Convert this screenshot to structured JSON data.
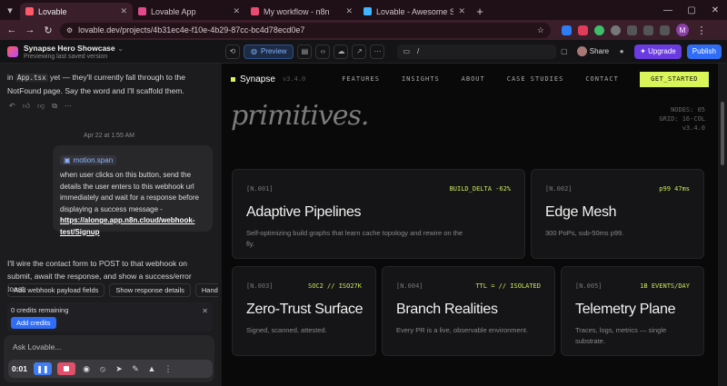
{
  "browser": {
    "tabs": [
      {
        "title": "Lovable",
        "color": "#ff5a6a",
        "active": true
      },
      {
        "title": "Lovable App",
        "color": "#e24a8c",
        "active": false
      },
      {
        "title": "My workflow - n8n",
        "color": "#ea4b71",
        "active": false
      },
      {
        "title": "Lovable - Awesome Screenshot",
        "color": "#3fb6ff",
        "active": false
      }
    ],
    "url": "lovable.dev/projects/4b31ec4e-f10e-4b29-87cc-bc4d78ecd0e7",
    "profile_initial": "M",
    "ext_badge": "0:01"
  },
  "app": {
    "project_name": "Synapse Hero Showcase",
    "project_status": "Previewing last saved version",
    "preview_label": "Preview",
    "route": "/",
    "share_label": "Share",
    "upgrade_label": "Upgrade",
    "publish_label": "Publish"
  },
  "chat": {
    "msg1_a": "in ",
    "msg1_code": "App.tsx",
    "msg1_b": " yet — they'll currently fall through to the NotFound page. Say the word and I'll scaffold them.",
    "date": "Apr 22 at 1:55 AM",
    "chip_label": "motion.span",
    "user_msg": "when user clicks on this button, send the details the user enters to this webhook url immediately and wait for a response before displaying a success message - ",
    "user_link": "https://alonge.app.n8n.cloud/webhook-test/Signup",
    "msg2": "I'll wire the contact form to POST to that webhook on submit, await the response, and show a success/error toast.",
    "suggestions": [
      "Add webhook payload fields",
      "Show response details",
      "Handle"
    ],
    "credits_text": "0 credits remaining",
    "add_credits": "Add credits",
    "ask_placeholder": "Ask Lovable...",
    "rec_time": "0:01"
  },
  "site": {
    "brand": "Synapse",
    "version": "v3.4.0",
    "nav": [
      "FEATURES",
      "INSIGHTS",
      "ABOUT",
      "CASE STUDIES",
      "CONTACT"
    ],
    "cta": "GET_STARTED",
    "hero_word": "primitives.",
    "meta": [
      "NODES: 05",
      "GRID: 16-COL",
      "v3.4.0"
    ],
    "cards": [
      {
        "id": "[N.001]",
        "tag": "BUILD_DELTA -62%",
        "title": "Adaptive Pipelines",
        "desc": "Self-optimizing build graphs that learn cache topology and rewire on the fly."
      },
      {
        "id": "[N.002]",
        "tag": "p99 47ms",
        "title": "Edge Mesh",
        "desc": "300 PoPs, sub-50ms p99."
      },
      {
        "id": "[N.003]",
        "tag": "SOC2 // ISO27K",
        "title": "Zero-Trust Surface",
        "desc": "Signed, scanned, attested."
      },
      {
        "id": "[N.004]",
        "tag": "TTL = // ISOLATED",
        "title": "Branch Realities",
        "desc": "Every PR is a live, observable environment."
      },
      {
        "id": "[N.005]",
        "tag": "1B EVENTS/DAY",
        "title": "Telemetry Plane",
        "desc": "Traces, logs, metrics — single substrate."
      }
    ]
  }
}
